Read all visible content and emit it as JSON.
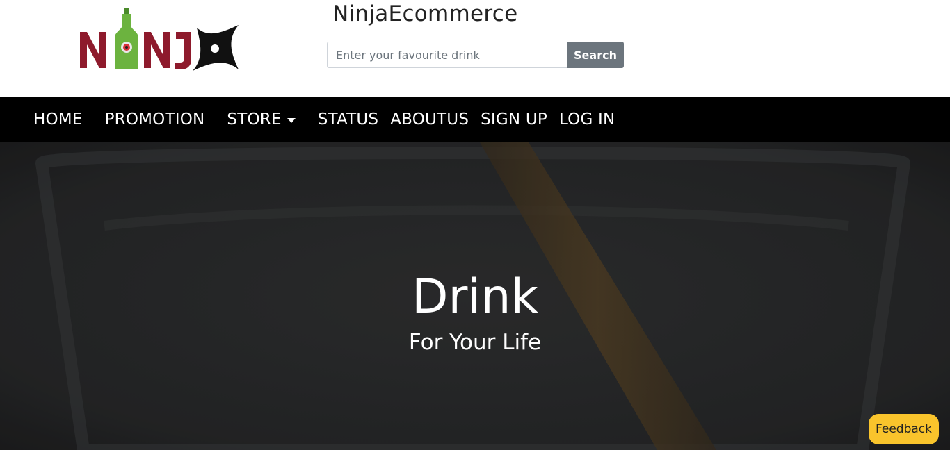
{
  "header": {
    "brand": "NinjaEcommerce",
    "logo_text": "NINJA",
    "search": {
      "placeholder": "Enter your favourite drink",
      "value": "",
      "button_label": "Search"
    }
  },
  "nav": {
    "items": [
      {
        "label": "HOME"
      },
      {
        "label": "PROMOTION"
      },
      {
        "label": "STORE",
        "dropdown": true
      },
      {
        "label": "STATUS"
      },
      {
        "label": "ABOUTUS"
      },
      {
        "label": "SIGN UP"
      },
      {
        "label": "LOG IN"
      }
    ]
  },
  "hero": {
    "title": "Drink",
    "subtitle": "For Your Life"
  },
  "feedback_label": "Feedback",
  "colors": {
    "logo_red": "#8e1a2c",
    "logo_green": "#6cb33f",
    "nav_bg": "#000000",
    "search_button": "#6c757d",
    "feedback_bg": "#f9c42c"
  },
  "icons": [
    "ninja-bottle-logo",
    "shuriken-icon",
    "chevron-down-icon"
  ]
}
